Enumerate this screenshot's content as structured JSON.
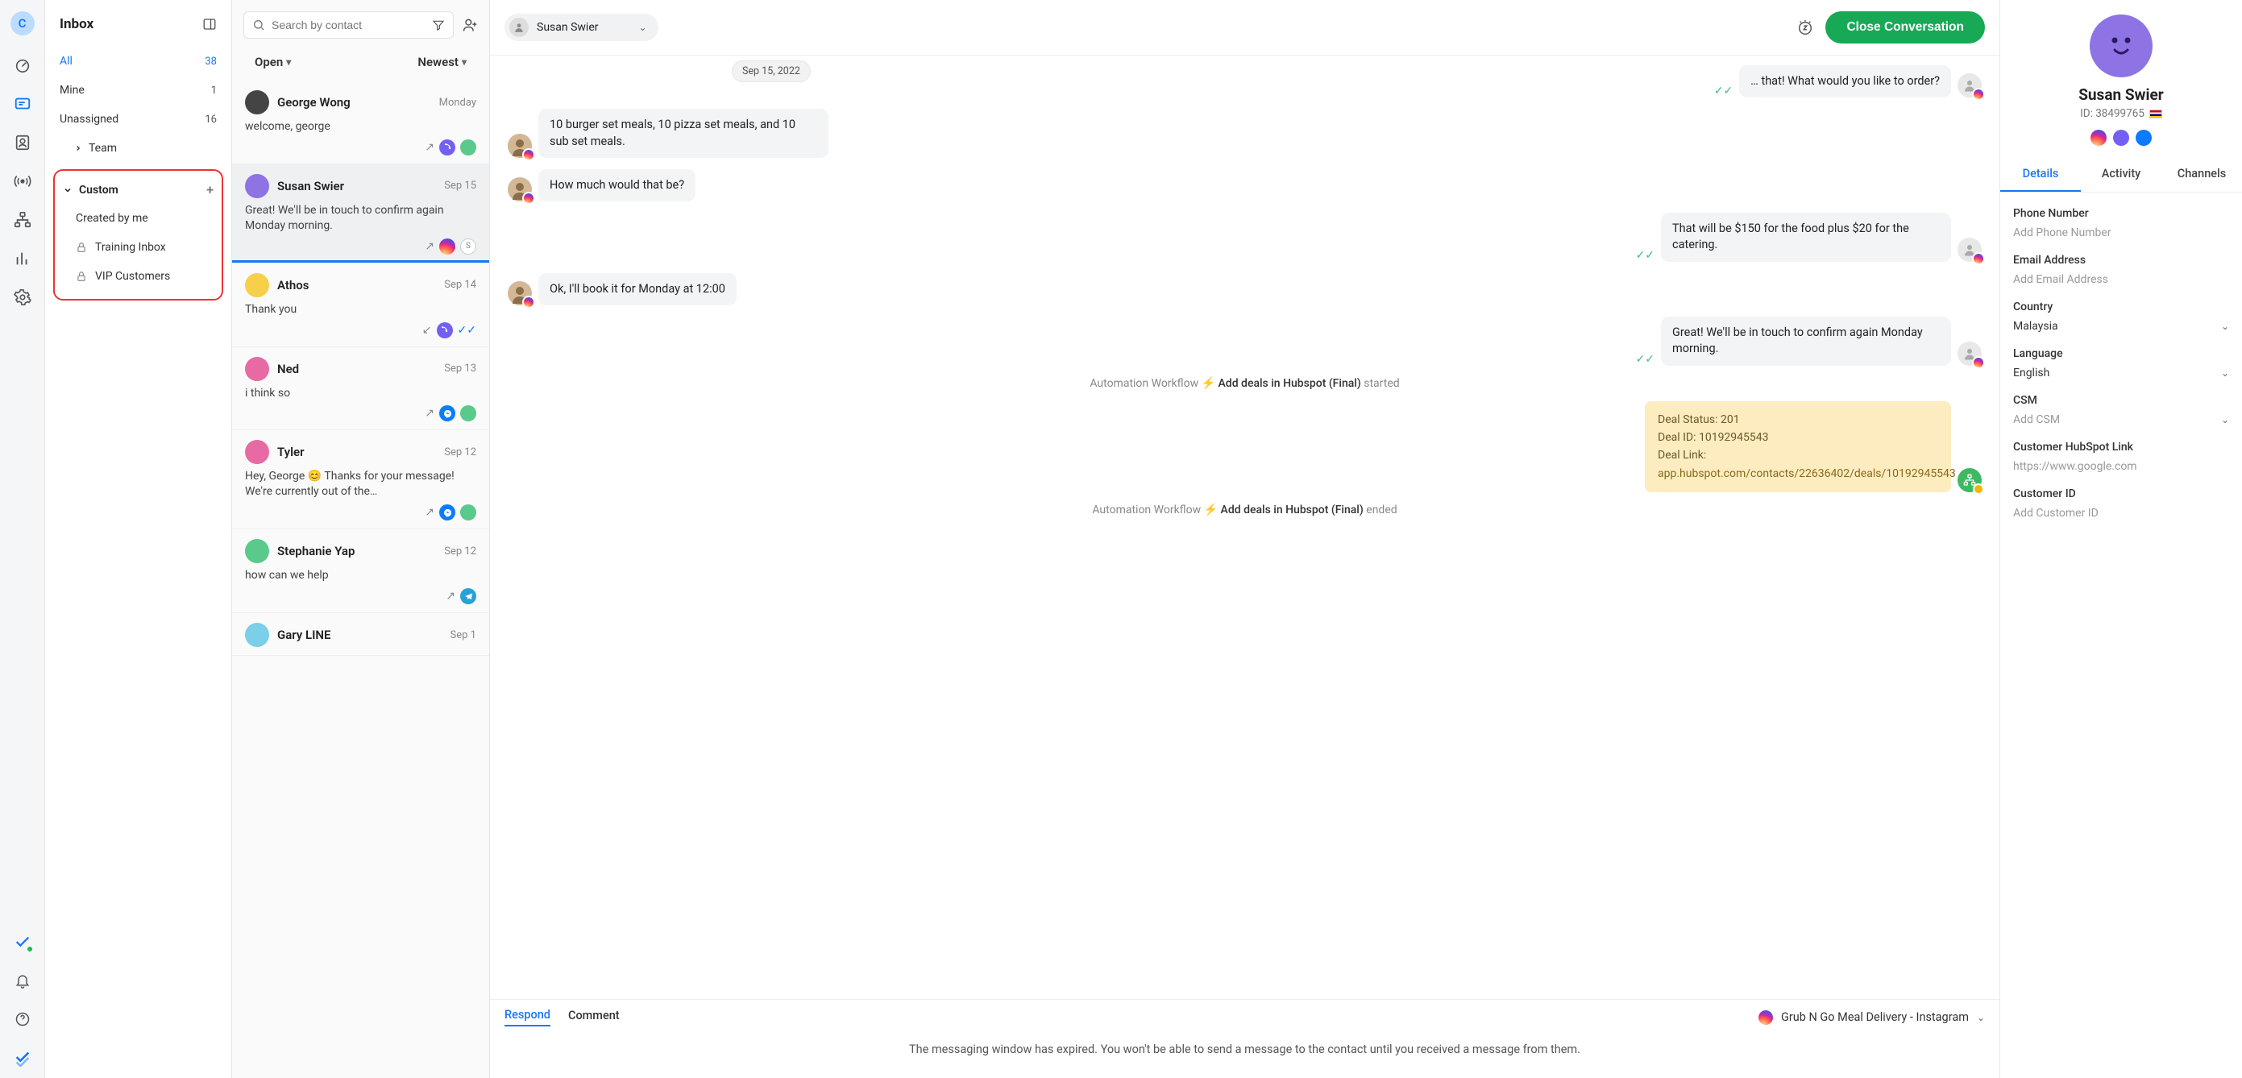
{
  "rail": {
    "avatar_letter": "C"
  },
  "sidebar": {
    "title": "Inbox",
    "folders": [
      {
        "label": "All",
        "count": "38",
        "active": true
      },
      {
        "label": "Mine",
        "count": "1"
      },
      {
        "label": "Unassigned",
        "count": "16"
      },
      {
        "label": "Team",
        "count": ""
      }
    ],
    "custom": {
      "heading": "Custom",
      "sub": "Created by me",
      "items": [
        {
          "label": "Training Inbox"
        },
        {
          "label": "VIP Customers"
        }
      ]
    }
  },
  "convlist": {
    "search_placeholder": "Search by contact",
    "status_filter": "Open",
    "sort_filter": "Newest",
    "items": [
      {
        "name": "George Wong",
        "date": "Monday",
        "preview": "welcome, george",
        "av_bg": "#444",
        "foot": [
          "arrow-out",
          "viber",
          "green"
        ]
      },
      {
        "name": "Susan Swier",
        "date": "Sep 15",
        "preview": "Great! We'll be in touch to confirm again Monday morning.",
        "selected": true,
        "av_bg": "#8d73e4",
        "foot": [
          "arrow-out",
          "ig",
          "outline-s"
        ]
      },
      {
        "name": "Athos",
        "date": "Sep 14",
        "preview": "Thank you",
        "av_bg": "#f7cf4a",
        "foot": [
          "arrow-in",
          "viber",
          "double-check"
        ]
      },
      {
        "name": "Ned",
        "date": "Sep 13",
        "preview": "i think so",
        "av_bg": "#e86aa4",
        "foot": [
          "arrow-out",
          "fbm",
          "green"
        ]
      },
      {
        "name": "Tyler",
        "date": "Sep 12",
        "preview": "Hey, George 😊 Thanks for your message! We're currently out of the…",
        "av_bg": "#e86aa4",
        "foot": [
          "arrow-out",
          "fbm",
          "green"
        ]
      },
      {
        "name": "Stephanie Yap",
        "date": "Sep 12",
        "preview": "how can we help",
        "av_bg": "#59c98c",
        "foot": [
          "arrow-out",
          "tg"
        ]
      },
      {
        "name": "Gary LINE",
        "date": "Sep 1",
        "preview": "",
        "av_bg": "#7bcfe8"
      }
    ]
  },
  "chat": {
    "header": {
      "contact_name": "Susan Swier",
      "close_label": "Close Conversation"
    },
    "date_pill": "Sep 15, 2022",
    "messages": [
      {
        "side": "right",
        "text": "… that! What would you like to order?",
        "truncated_front": true
      },
      {
        "side": "left",
        "text": "10 burger set meals, 10 pizza set meals, and 10 sub set meals."
      },
      {
        "side": "left",
        "text": "How much would that be?"
      },
      {
        "side": "right",
        "text": "That will be $150 for the food plus $20 for the catering."
      },
      {
        "side": "left",
        "text": "Ok, I'll book it for Monday at 12:00"
      },
      {
        "side": "right",
        "text": "Great! We'll be in touch to confirm again Monday morning."
      }
    ],
    "workflow": {
      "prefix": "Automation Workflow",
      "name": "Add deals in Hubspot (Final)",
      "started": "started",
      "ended": "ended"
    },
    "deal_box": {
      "l1": "Deal Status: 201",
      "l2": "Deal ID: 10192945543",
      "l3": "Deal Link:",
      "l4": "app.hubspot.com/contacts/22636402/deals/10192945543"
    },
    "input": {
      "tab_respond": "Respond",
      "tab_comment": "Comment",
      "channel": "Grub N Go Meal Delivery - Instagram",
      "expired": "The messaging window has expired. You won't be able to send a message to the contact until you received a message from them."
    }
  },
  "details": {
    "name": "Susan Swier",
    "id_label": "ID: 38499765",
    "tabs": {
      "details": "Details",
      "activity": "Activity",
      "channels": "Channels"
    },
    "fields": [
      {
        "label": "Phone Number",
        "value": "Add Phone Number",
        "placeholder": true
      },
      {
        "label": "Email Address",
        "value": "Add Email Address",
        "placeholder": true
      },
      {
        "label": "Country",
        "value": "Malaysia",
        "dropdown": true
      },
      {
        "label": "Language",
        "value": "English",
        "dropdown": true
      },
      {
        "label": "CSM",
        "value": "Add CSM",
        "placeholder": true,
        "dropdown": true
      },
      {
        "label": "Customer HubSpot Link",
        "value": "https://www.google.com",
        "placeholder": true
      },
      {
        "label": "Customer ID",
        "value": "Add Customer ID",
        "placeholder": true
      }
    ]
  }
}
